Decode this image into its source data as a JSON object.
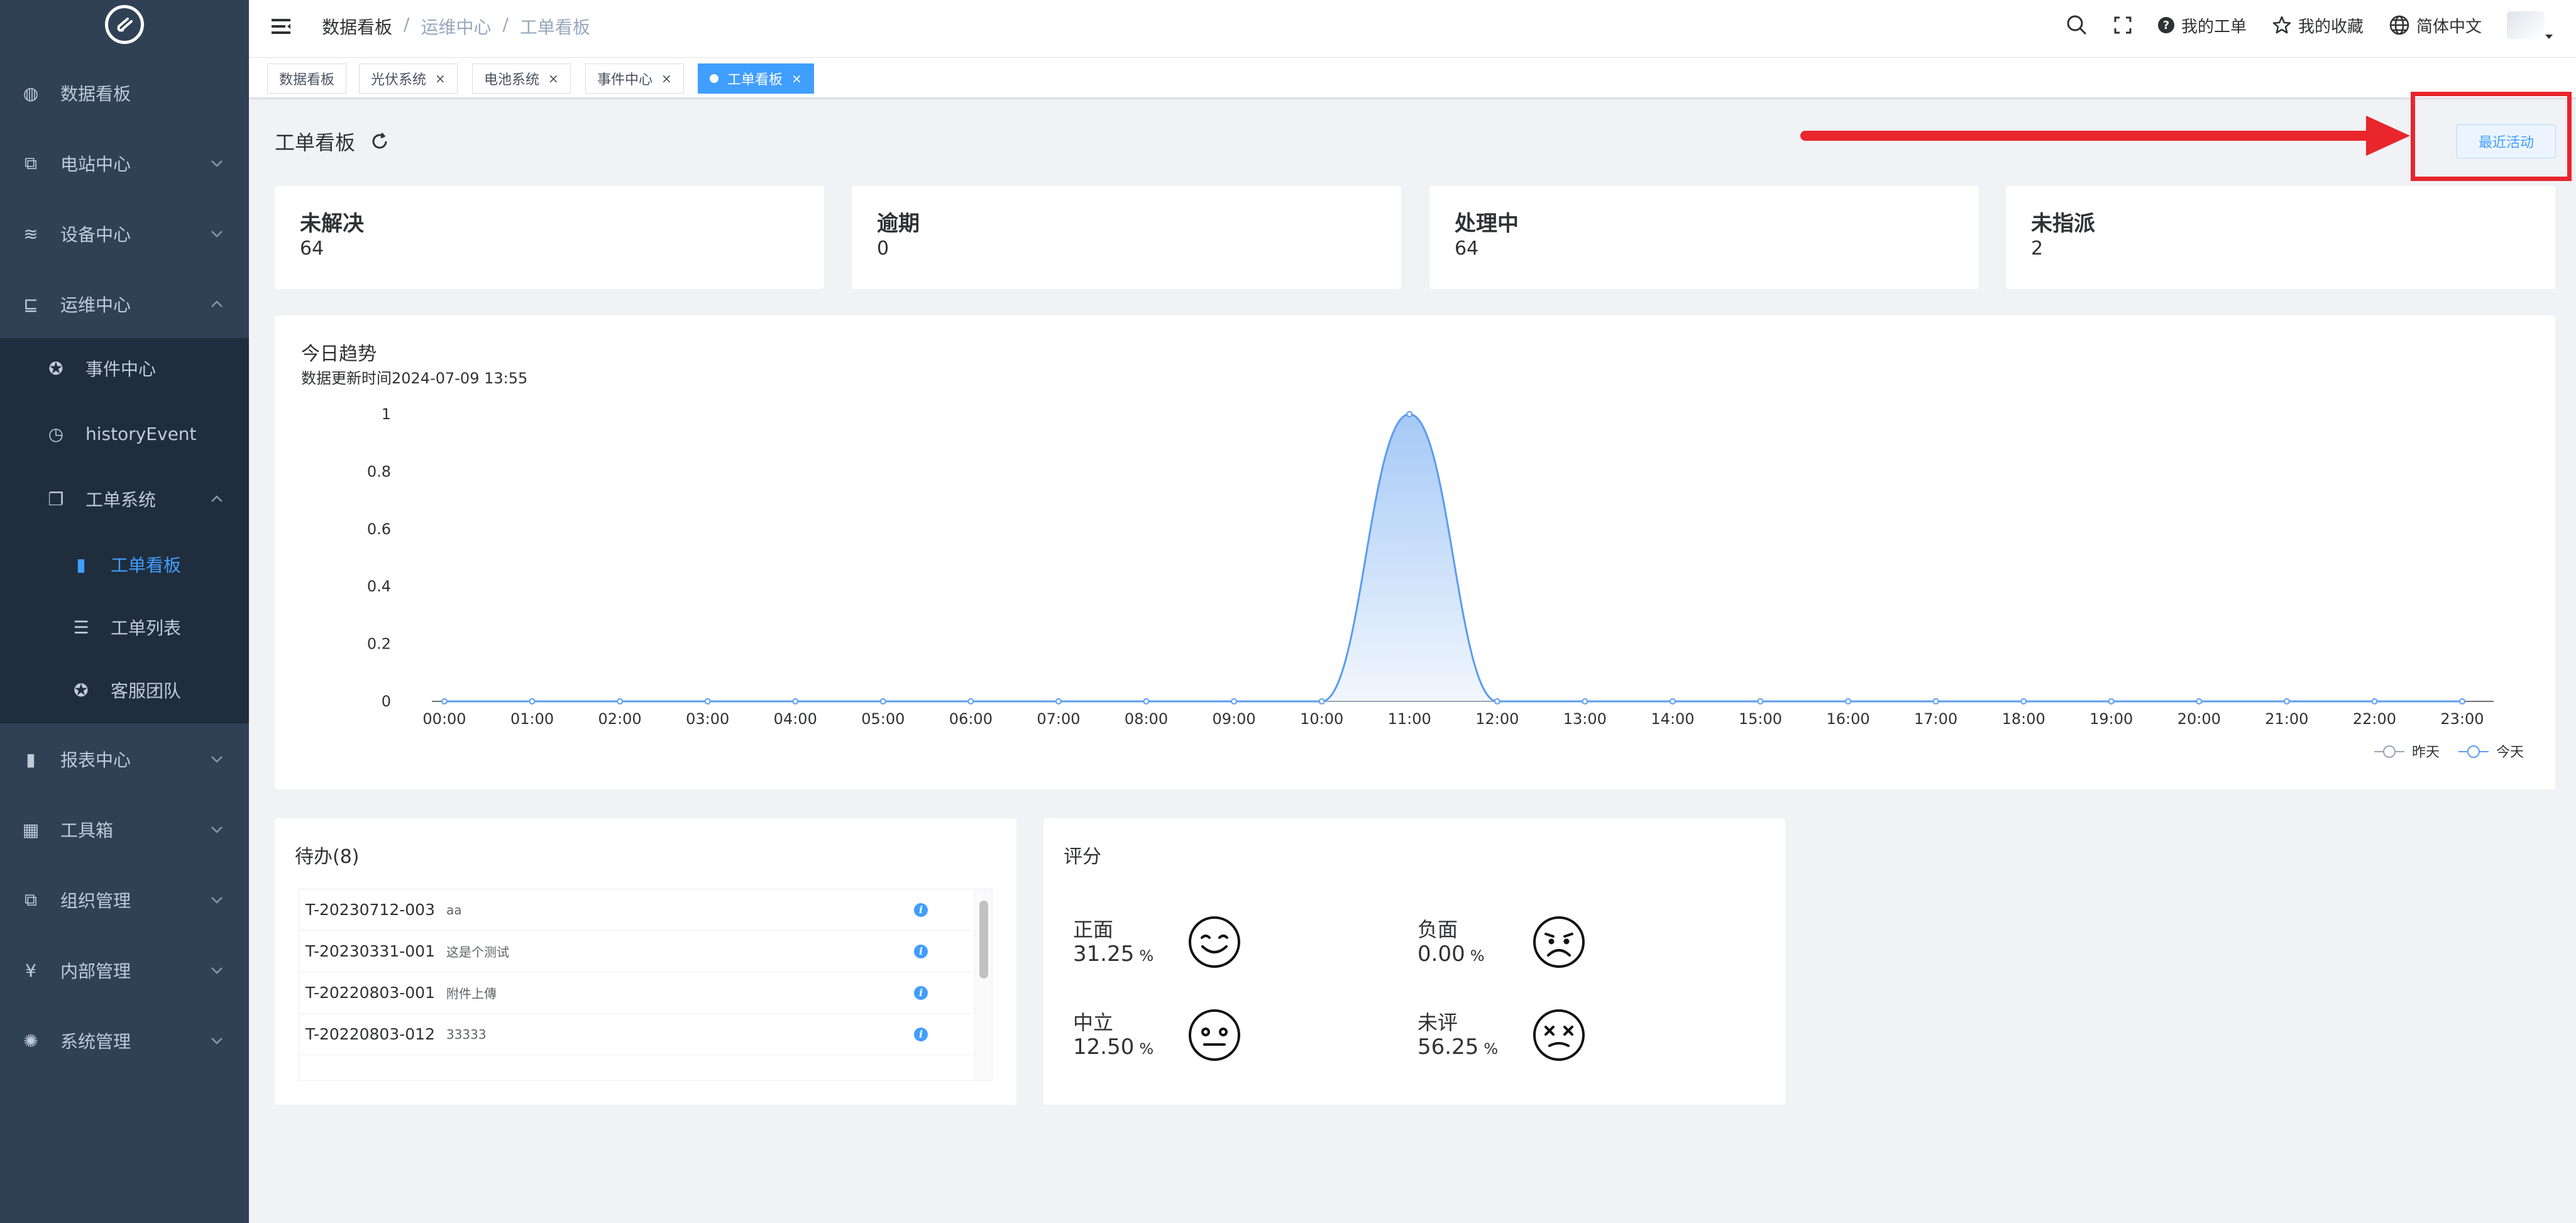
{
  "sidebar": {
    "items": [
      {
        "label": "数据看板",
        "icon": "dashboard-icon"
      },
      {
        "label": "电站中心",
        "icon": "sitemap-icon"
      },
      {
        "label": "设备中心",
        "icon": "layers-icon"
      },
      {
        "label": "运维中心",
        "icon": "tree-icon"
      },
      {
        "label": "事件中心",
        "icon": "lifebuoy-icon"
      },
      {
        "label": "historyEvent",
        "icon": "clock-icon"
      },
      {
        "label": "工单系统",
        "icon": "copy-icon"
      },
      {
        "label": "工单看板",
        "icon": "bar-chart-icon"
      },
      {
        "label": "工单列表",
        "icon": "list-icon"
      },
      {
        "label": "客服团队",
        "icon": "lifebuoy-icon"
      },
      {
        "label": "报表中心",
        "icon": "bar-chart-icon"
      },
      {
        "label": "工具箱",
        "icon": "table-icon"
      },
      {
        "label": "组织管理",
        "icon": "sitemap-icon"
      },
      {
        "label": "内部管理",
        "icon": "yen-icon"
      },
      {
        "label": "系统管理",
        "icon": "gear-icon"
      }
    ]
  },
  "navbar": {
    "breadcrumb": [
      "数据看板",
      "运维中心",
      "工单看板"
    ],
    "my_tickets": "我的工单",
    "my_favorites": "我的收藏",
    "language": "简体中文"
  },
  "tags": [
    {
      "label": "数据看板",
      "closable": false,
      "active": false
    },
    {
      "label": "光伏系统",
      "closable": true,
      "active": false
    },
    {
      "label": "电池系统",
      "closable": true,
      "active": false
    },
    {
      "label": "事件中心",
      "closable": true,
      "active": false
    },
    {
      "label": "工单看板",
      "closable": true,
      "active": true
    }
  ],
  "page": {
    "title": "工单看板",
    "recent_activity": "最近活动"
  },
  "stats": [
    {
      "label": "未解决",
      "value": "64"
    },
    {
      "label": "逾期",
      "value": "0"
    },
    {
      "label": "处理中",
      "value": "64"
    },
    {
      "label": "未指派",
      "value": "2"
    }
  ],
  "chart": {
    "title": "今日趋势",
    "subtitle": "数据更新时间2024-07-09 13:55"
  },
  "chart_data": {
    "type": "area",
    "x": [
      "00:00",
      "01:00",
      "02:00",
      "03:00",
      "04:00",
      "05:00",
      "06:00",
      "07:00",
      "08:00",
      "09:00",
      "10:00",
      "11:00",
      "12:00",
      "13:00",
      "14:00",
      "15:00",
      "16:00",
      "17:00",
      "18:00",
      "19:00",
      "20:00",
      "21:00",
      "22:00",
      "23:00"
    ],
    "yticks": [
      "0",
      "0.2",
      "0.4",
      "0.6",
      "0.8",
      "1"
    ],
    "ylim": [
      0,
      1
    ],
    "series": [
      {
        "name": "昨天",
        "values": [
          0,
          0,
          0,
          0,
          0,
          0,
          0,
          0,
          0,
          0,
          0,
          0,
          0,
          0,
          0,
          0,
          0,
          0,
          0,
          0,
          0,
          0,
          0,
          0
        ]
      },
      {
        "name": "今天",
        "values": [
          0,
          0,
          0,
          0,
          0,
          0,
          0,
          0,
          0,
          0,
          0,
          1,
          0,
          0,
          0,
          0,
          0,
          0,
          0,
          0,
          0,
          0,
          0,
          0
        ]
      }
    ],
    "legend_position": "bottom-right",
    "colors": {
      "today": "#5b9cf0",
      "yesterday": "#9aa4b1"
    }
  },
  "todo": {
    "title": "待办(8)",
    "items": [
      {
        "code": "T-20230712-003",
        "desc": "aa"
      },
      {
        "code": "T-20230331-001",
        "desc": "这是个测试"
      },
      {
        "code": "T-20220803-001",
        "desc": "附件上傳"
      },
      {
        "code": "T-20220803-012",
        "desc": "33333"
      }
    ]
  },
  "rating": {
    "title": "评分",
    "items": [
      {
        "label": "正面",
        "value": "31.25",
        "unit": "%",
        "face": "smile"
      },
      {
        "label": "负面",
        "value": "0.00",
        "unit": "%",
        "face": "sad"
      },
      {
        "label": "中立",
        "value": "12.50",
        "unit": "%",
        "face": "neutral"
      },
      {
        "label": "未评",
        "value": "56.25",
        "unit": "%",
        "face": "dead"
      }
    ]
  }
}
